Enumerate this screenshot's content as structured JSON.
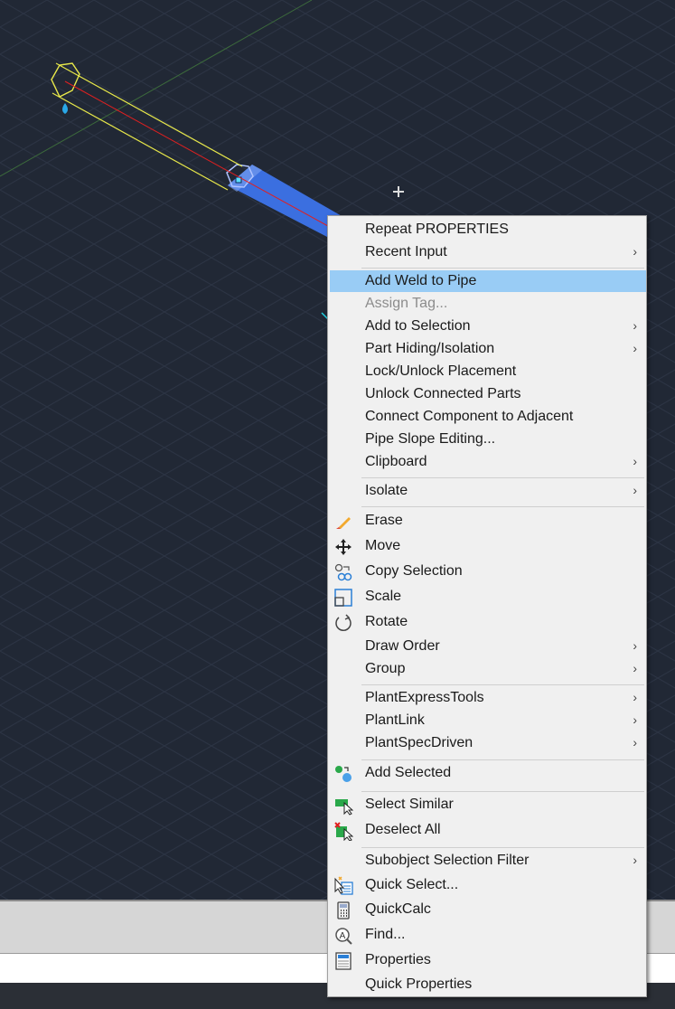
{
  "colors": {
    "viewport_bg": "#212835",
    "pipe_selected": "#3b6fe0",
    "pipe_wire": "#e8e84a",
    "centerline": "#e02020",
    "menu_highlight": "#99ccf5",
    "menu_bg": "#f0f0f0"
  },
  "context_menu": {
    "items": [
      {
        "label": "Repeat PROPERTIES",
        "submenu": false
      },
      {
        "label": "Recent Input",
        "submenu": true
      },
      {
        "label": "Add Weld to Pipe",
        "submenu": false,
        "highlighted": true
      },
      {
        "label": "Assign Tag...",
        "submenu": false,
        "disabled": true
      },
      {
        "label": "Add to Selection",
        "submenu": true
      },
      {
        "label": "Part Hiding/Isolation",
        "submenu": true
      },
      {
        "label": "Lock/Unlock Placement",
        "submenu": false
      },
      {
        "label": "Unlock Connected Parts",
        "submenu": false
      },
      {
        "label": "Connect Component to Adjacent",
        "submenu": false
      },
      {
        "label": "Pipe Slope Editing...",
        "submenu": false
      },
      {
        "label": "Clipboard",
        "submenu": true
      },
      {
        "label": "Isolate",
        "submenu": true
      },
      {
        "label": "Erase",
        "submenu": false,
        "icon": "erase-icon"
      },
      {
        "label": "Move",
        "submenu": false,
        "icon": "move-icon"
      },
      {
        "label": "Copy Selection",
        "submenu": false,
        "icon": "copy-icon"
      },
      {
        "label": "Scale",
        "submenu": false,
        "icon": "scale-icon"
      },
      {
        "label": "Rotate",
        "submenu": false,
        "icon": "rotate-icon"
      },
      {
        "label": "Draw Order",
        "submenu": true
      },
      {
        "label": "Group",
        "submenu": true
      },
      {
        "label": "PlantExpressTools",
        "submenu": true
      },
      {
        "label": "PlantLink",
        "submenu": true
      },
      {
        "label": "PlantSpecDriven",
        "submenu": true
      },
      {
        "label": "Add Selected",
        "submenu": false,
        "icon": "add-selected-icon"
      },
      {
        "label": "Select Similar",
        "submenu": false,
        "icon": "select-similar-icon"
      },
      {
        "label": "Deselect All",
        "submenu": false,
        "icon": "deselect-all-icon"
      },
      {
        "label": "Subobject Selection Filter",
        "submenu": true
      },
      {
        "label": "Quick Select...",
        "submenu": false,
        "icon": "quick-select-icon"
      },
      {
        "label": "QuickCalc",
        "submenu": false,
        "icon": "calculator-icon"
      },
      {
        "label": "Find...",
        "submenu": false,
        "icon": "find-icon"
      },
      {
        "label": "Properties",
        "submenu": false,
        "icon": "properties-icon"
      },
      {
        "label": "Quick Properties",
        "submenu": false
      }
    ],
    "submenu_arrow": "›"
  }
}
